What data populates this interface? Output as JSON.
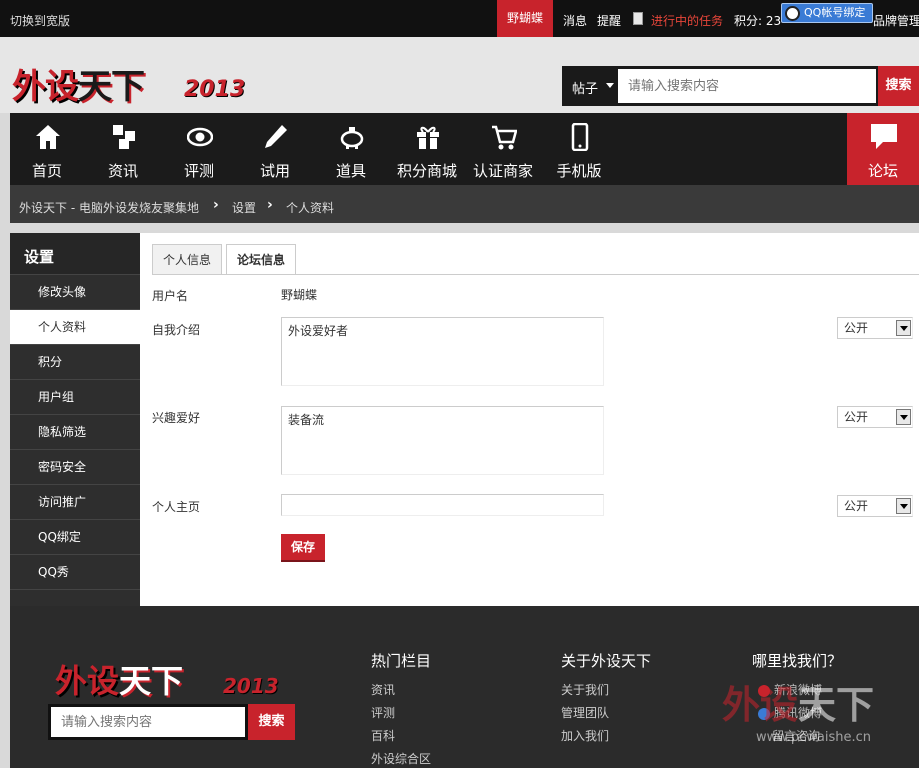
{
  "topbar": {
    "switch": "切换到宽版",
    "username": "野蝴蝶",
    "messages": "消息",
    "remind": "提醒",
    "task": "进行中的任务",
    "points": "积分: 23",
    "qq_bind": "QQ帐号绑定",
    "brand": "品牌管理"
  },
  "header": {
    "logo_red": "外设",
    "logo_dark": "天下",
    "logo_year": "2013",
    "search_type": "帖子",
    "search_placeholder": "请输入搜索内容",
    "search_button": "搜索"
  },
  "nav": {
    "items": [
      {
        "label": "首页",
        "icon": "home-icon"
      },
      {
        "label": "资讯",
        "icon": "news-icon"
      },
      {
        "label": "评测",
        "icon": "eye-icon"
      },
      {
        "label": "试用",
        "icon": "pencil-icon"
      },
      {
        "label": "道具",
        "icon": "piggy-icon"
      },
      {
        "label": "积分商城",
        "icon": "gift-icon"
      },
      {
        "label": "认证商家",
        "icon": "cart-icon"
      },
      {
        "label": "手机版",
        "icon": "phone-icon"
      }
    ],
    "forum": "论坛"
  },
  "breadcrumb": {
    "home": "外设天下 - 电脑外设发烧友聚集地",
    "settings": "设置",
    "current": "个人资料"
  },
  "sidebar": {
    "title": "设置",
    "items": [
      "修改头像",
      "个人资料",
      "积分",
      "用户组",
      "隐私筛选",
      "密码安全",
      "访问推广",
      "QQ绑定",
      "QQ秀"
    ]
  },
  "profile": {
    "tabs": [
      "个人信息",
      "论坛信息"
    ],
    "username_label": "用户名",
    "username_value": "野蝴蝶",
    "intro_label": "自我介绍",
    "intro_value": "外设爱好者",
    "hobby_label": "兴趣爱好",
    "hobby_value": "装备流",
    "homepage_label": "个人主页",
    "homepage_value": "",
    "privacy": "公开",
    "save": "保存"
  },
  "footer": {
    "logo_red": "外设",
    "logo_dark": "天下",
    "logo_year": "2013",
    "search_placeholder": "请输入搜索内容",
    "search_button": "搜索",
    "col1_title": "热门栏目",
    "col1_links": [
      "资讯",
      "评测",
      "百科",
      "外设综合区"
    ],
    "col2_title": "关于外设天下",
    "col2_links": [
      "关于我们",
      "管理团队",
      "加入我们"
    ],
    "col3_title": "哪里找我们？",
    "col3_links": [
      "新浪微博",
      "腾讯微博",
      "留言咨询"
    ],
    "watermark_red": "外设",
    "watermark_white": "天下",
    "watermark_url": "www.pcwaishe.cn"
  },
  "colors": {
    "accent_red": "#c8232c",
    "nav_bg": "#1b1b1b",
    "qq_blue": "#3a7bd5"
  }
}
